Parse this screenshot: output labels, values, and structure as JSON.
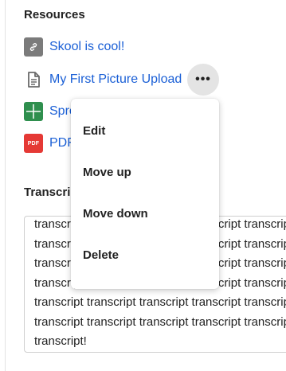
{
  "resources": {
    "heading": "Resources",
    "items": [
      {
        "label": "Skool is cool!",
        "icon": "link-icon"
      },
      {
        "label": "My First Picture Upload",
        "icon": "file-icon"
      },
      {
        "label": "Spre",
        "icon": "spreadsheet-icon"
      },
      {
        "label": "PDF",
        "icon": "pdf-icon",
        "badge": "PDF"
      }
    ],
    "more_label": "•••"
  },
  "menu": {
    "items": [
      {
        "label": "Edit"
      },
      {
        "label": "Move up"
      },
      {
        "label": "Move down"
      },
      {
        "label": "Delete"
      }
    ]
  },
  "transcript": {
    "heading": "Transcri",
    "lines": [
      "transcript transcript transcript transcript transcript",
      "transcript transcript transcript transcript transcript",
      "transcript transcript transcript transcript transcript",
      "transcript transcript transcript transcript transcript",
      "transcript transcript transcript transcript transcript",
      "transcript transcript transcript transcript transcript",
      "transcript!"
    ]
  },
  "colors": {
    "link": "#1a5fd6",
    "sheet": "#2f8f4e",
    "pdf": "#e53935",
    "link_icon_bg": "#7b7b7b"
  }
}
